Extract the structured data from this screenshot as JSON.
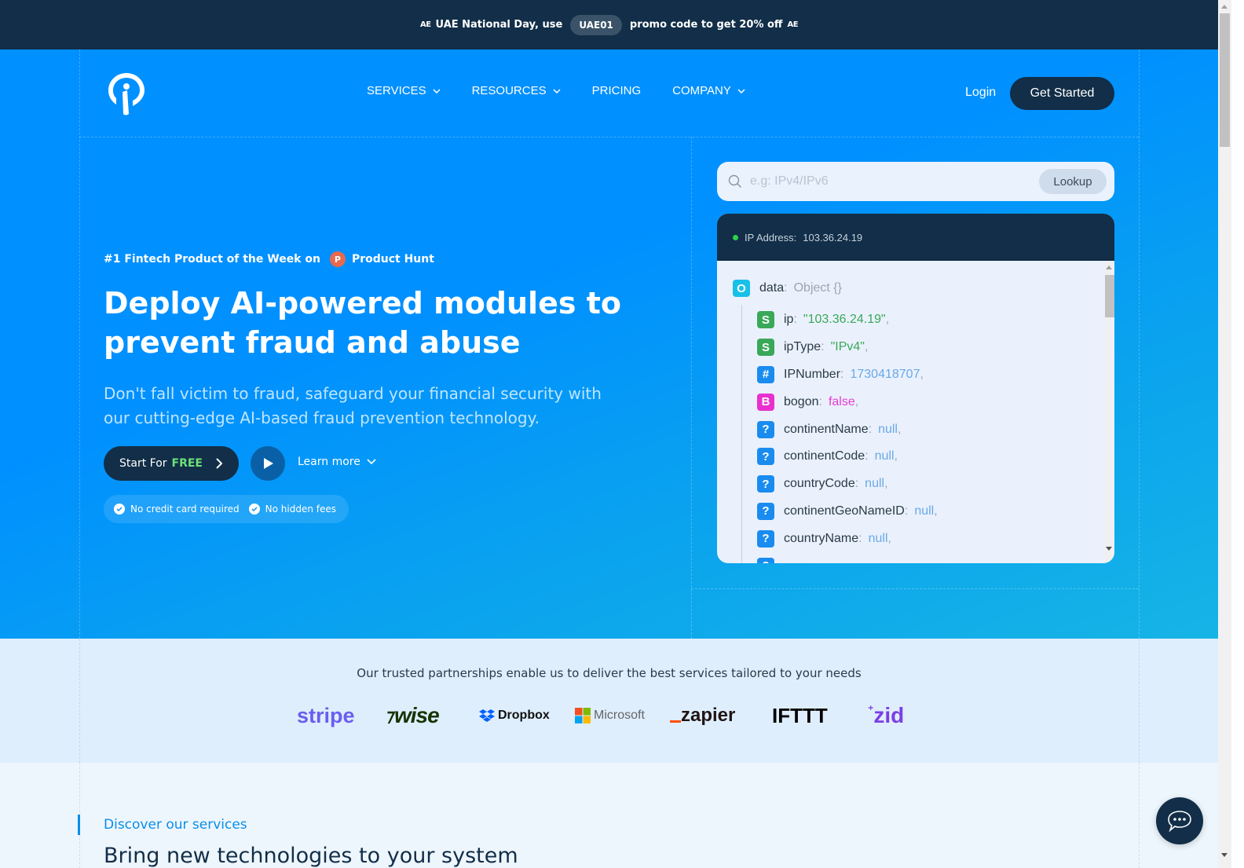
{
  "promo": {
    "flag_left": "AE",
    "text_before": "UAE National Day, use",
    "code": "UAE01",
    "text_after": "promo code to get 20% off",
    "flag_right": "AE"
  },
  "nav": {
    "items": [
      {
        "label": "SERVICES",
        "dropdown": true
      },
      {
        "label": "RESOURCES",
        "dropdown": true
      },
      {
        "label": "PRICING",
        "dropdown": false
      },
      {
        "label": "COMPANY",
        "dropdown": true
      }
    ],
    "login": "Login",
    "get_started": "Get Started"
  },
  "hero": {
    "award_text": "#1 Fintech Product of the Week on",
    "award_badge": "P",
    "award_site": "Product Hunt",
    "headline": "Deploy AI-powered modules to prevent fraud and abuse",
    "subtext": "Don't fall victim to fraud, safeguard your financial security with our cutting-edge AI-based fraud prevention technology.",
    "start_label": "Start For",
    "start_free": "FREE",
    "learn_more": "Learn more",
    "badges": [
      "No credit card required",
      "No hidden fees"
    ]
  },
  "lookup": {
    "placeholder": "e.g: IPv4/IPv6",
    "value": "",
    "button": "Lookup"
  },
  "result": {
    "status_label": "IP Address:",
    "ip": "103.36.24.19",
    "root": {
      "tag": "O",
      "key": "data",
      "value": "Object {}"
    },
    "rows": [
      {
        "tag": "S",
        "key": "ip",
        "value": "\"103.36.24.19\"",
        "type": "str"
      },
      {
        "tag": "S",
        "key": "ipType",
        "value": "\"IPv4\"",
        "type": "str"
      },
      {
        "tag": "#",
        "key": "IPNumber",
        "value": "1730418707",
        "type": "num"
      },
      {
        "tag": "B",
        "key": "bogon",
        "value": "false",
        "type": "bool"
      },
      {
        "tag": "?",
        "key": "continentName",
        "value": "null",
        "type": "null"
      },
      {
        "tag": "?",
        "key": "continentCode",
        "value": "null",
        "type": "null"
      },
      {
        "tag": "?",
        "key": "countryCode",
        "value": "null",
        "type": "null"
      },
      {
        "tag": "?",
        "key": "continentGeoNameID",
        "value": "null",
        "type": "null"
      },
      {
        "tag": "?",
        "key": "countryName",
        "value": "null",
        "type": "null"
      },
      {
        "tag": "?",
        "key": "",
        "value": "",
        "type": "null"
      }
    ],
    "tag_colors": {
      "O": "#17c0e8",
      "S": "#3aa859",
      "#": "#1a8cf0",
      "B": "#e930cf",
      "?": "#1a8cf0"
    }
  },
  "partners": {
    "text": "Our trusted partnerships enable us to deliver the best services tailored to your needs",
    "logos": [
      "stripe",
      "wise",
      "Dropbox",
      "Microsoft",
      "zapier",
      "IFTTT",
      "zid"
    ]
  },
  "services": {
    "label": "Discover our services",
    "title": "Bring new technologies to your system"
  },
  "colors": {
    "brand_dark": "#122e48",
    "brand_blue": "#0090ff",
    "accent_green": "#6fe07a"
  }
}
